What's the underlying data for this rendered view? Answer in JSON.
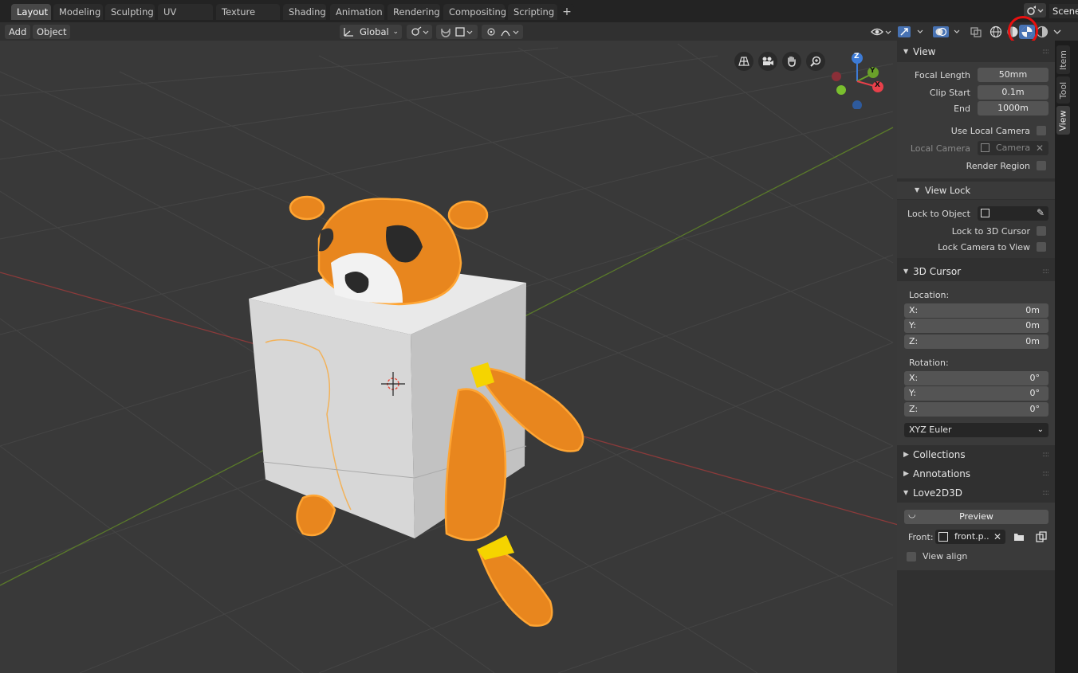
{
  "workspace_tabs": [
    "Layout",
    "Modeling",
    "Sculpting",
    "UV Editing",
    "Texture Paint",
    "Shading",
    "Animation",
    "Rendering",
    "Compositing",
    "Scripting"
  ],
  "add_workspace_symbol": "+",
  "scene_label": "Scene",
  "header": {
    "add_menu": "Add",
    "object_menu": "Object",
    "transform_orientation": "Global"
  },
  "viewport": {
    "gizmo_axes": {
      "z": "Z",
      "y": "Y",
      "x": "X"
    },
    "colors": {
      "background": "#393939",
      "grid": "#444444",
      "x_axis": "#8a3a3a",
      "y_axis": "#5a7a2a",
      "character": "#e8861e",
      "outline": "#ffaa33",
      "cube": "#d9d9d9"
    },
    "highlight_ring_color": "#e81010"
  },
  "sidebar_tabs": [
    "Item",
    "Tool",
    "View"
  ],
  "view_panel": {
    "title": "View",
    "focal_length_label": "Focal Length",
    "focal_length": "50mm",
    "clip_start_label": "Clip Start",
    "clip_start": "0.1m",
    "clip_end_label": "End",
    "clip_end": "1000m",
    "use_local_camera": "Use Local Camera",
    "local_camera_label": "Local Camera",
    "local_camera_value": "Camera",
    "render_region": "Render Region"
  },
  "view_lock_panel": {
    "title": "View Lock",
    "lock_to_object": "Lock to Object",
    "lock_to_3d_cursor": "Lock to 3D Cursor",
    "lock_camera_to_view": "Lock Camera to View"
  },
  "cursor_panel": {
    "title": "3D Cursor",
    "location_label": "Location:",
    "location": [
      {
        "axis": "X:",
        "value": "0m"
      },
      {
        "axis": "Y:",
        "value": "0m"
      },
      {
        "axis": "Z:",
        "value": "0m"
      }
    ],
    "rotation_label": "Rotation:",
    "rotation": [
      {
        "axis": "X:",
        "value": "0°"
      },
      {
        "axis": "Y:",
        "value": "0°"
      },
      {
        "axis": "Z:",
        "value": "0°"
      }
    ],
    "rotation_mode": "XYZ Euler"
  },
  "collections_panel": {
    "title": "Collections"
  },
  "annotations_panel": {
    "title": "Annotations"
  },
  "love2d3d_panel": {
    "title": "Love2D3D",
    "preview_button": "Preview",
    "front_label": "Front:",
    "front_value": "front.p..",
    "view_align": "View align"
  }
}
